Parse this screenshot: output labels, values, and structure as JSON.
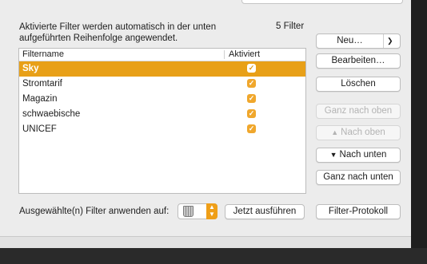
{
  "rules_panel": {
    "description": "Aktivierte Filter werden automatisch in der unten aufgeführten Reihenfolge angewendet.",
    "filter_count": "5 Filter"
  },
  "filter_list": {
    "columns": {
      "name": "Filtername",
      "active": "Aktiviert"
    },
    "rows": [
      {
        "name": "Sky",
        "active": true,
        "selected": true
      },
      {
        "name": "Stromtarif",
        "active": true,
        "selected": false
      },
      {
        "name": "Magazin",
        "active": true,
        "selected": false
      },
      {
        "name": "schwaebische",
        "active": true,
        "selected": false
      },
      {
        "name": "UNICEF",
        "active": true,
        "selected": false
      }
    ]
  },
  "buttons": {
    "new": "Neu…",
    "edit": "Bearbeiten…",
    "delete": "Löschen",
    "move_top": "Ganz nach oben",
    "move_up": "Nach oben",
    "move_down": "Nach unten",
    "move_bottom": "Ganz nach unten",
    "run_now": "Jetzt ausführen",
    "filter_log": "Filter-Protokoll"
  },
  "button_states": {
    "move_top_enabled": false,
    "move_up_enabled": false
  },
  "apply": {
    "label": "Ausgewählte(n) Filter anwenden auf:",
    "target_icon": "trash-can-icon"
  },
  "colors": {
    "accent": "#e8a018",
    "checkbox": "#f0a72c"
  }
}
